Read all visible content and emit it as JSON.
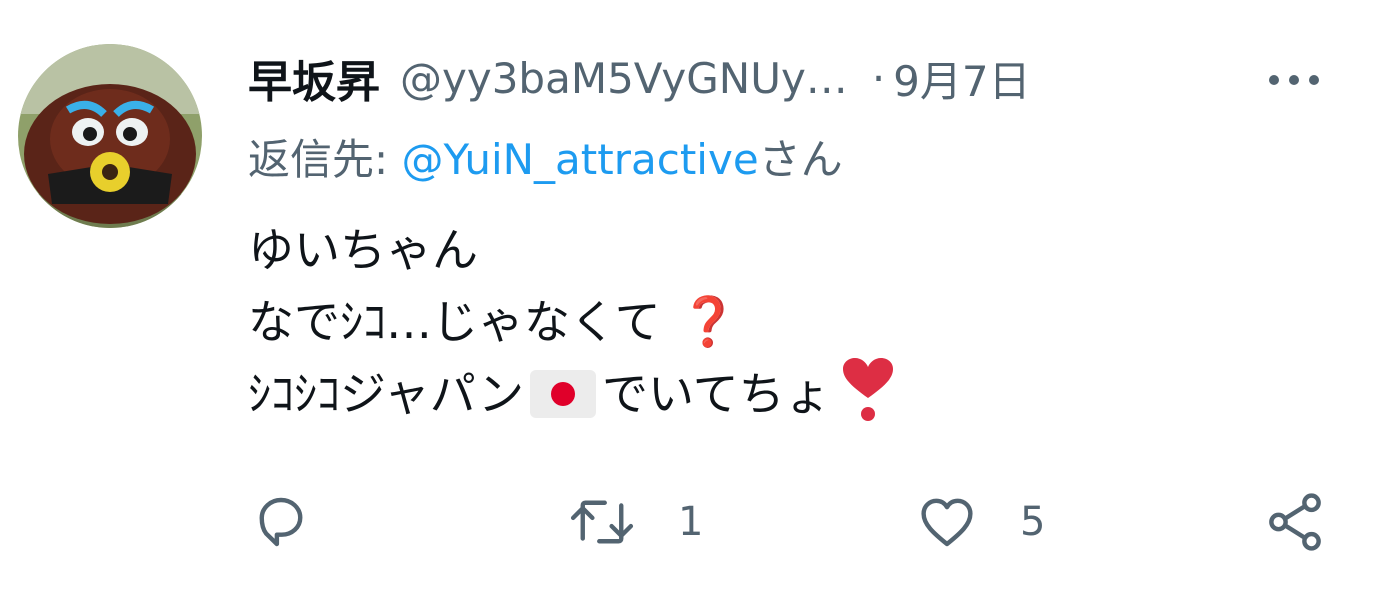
{
  "user": {
    "display_name": "早坂昇",
    "handle": "@yy3baM5VyGNUy…",
    "separator": "·",
    "date": "9月7日",
    "avatar_icon": "avatar-photo"
  },
  "reply": {
    "prefix": "返信先: ",
    "mention": "@YuiN_attractive",
    "suffix": "さん"
  },
  "body": {
    "line1": "ゆいちゃん",
    "line2": "なでｼｺ…じゃなくて",
    "line2_emoji": "❓",
    "line3_a": "ｼｺｼｺジャパン",
    "line3_flag": "japan-flag-icon",
    "line3_b": "でいてちょ",
    "line3_emoji": "heavy-heart-exclamation-icon"
  },
  "actions": {
    "reply_icon": "reply-icon",
    "retweet_icon": "retweet-icon",
    "retweet_count": "1",
    "like_icon": "heart-icon",
    "like_count": "5",
    "share_icon": "share-icon",
    "more_icon": "more-options-icon"
  },
  "colors": {
    "text": "#0f1419",
    "secondary": "#536471",
    "link": "#1d9bf0",
    "emoji_red": "#c8102e"
  }
}
